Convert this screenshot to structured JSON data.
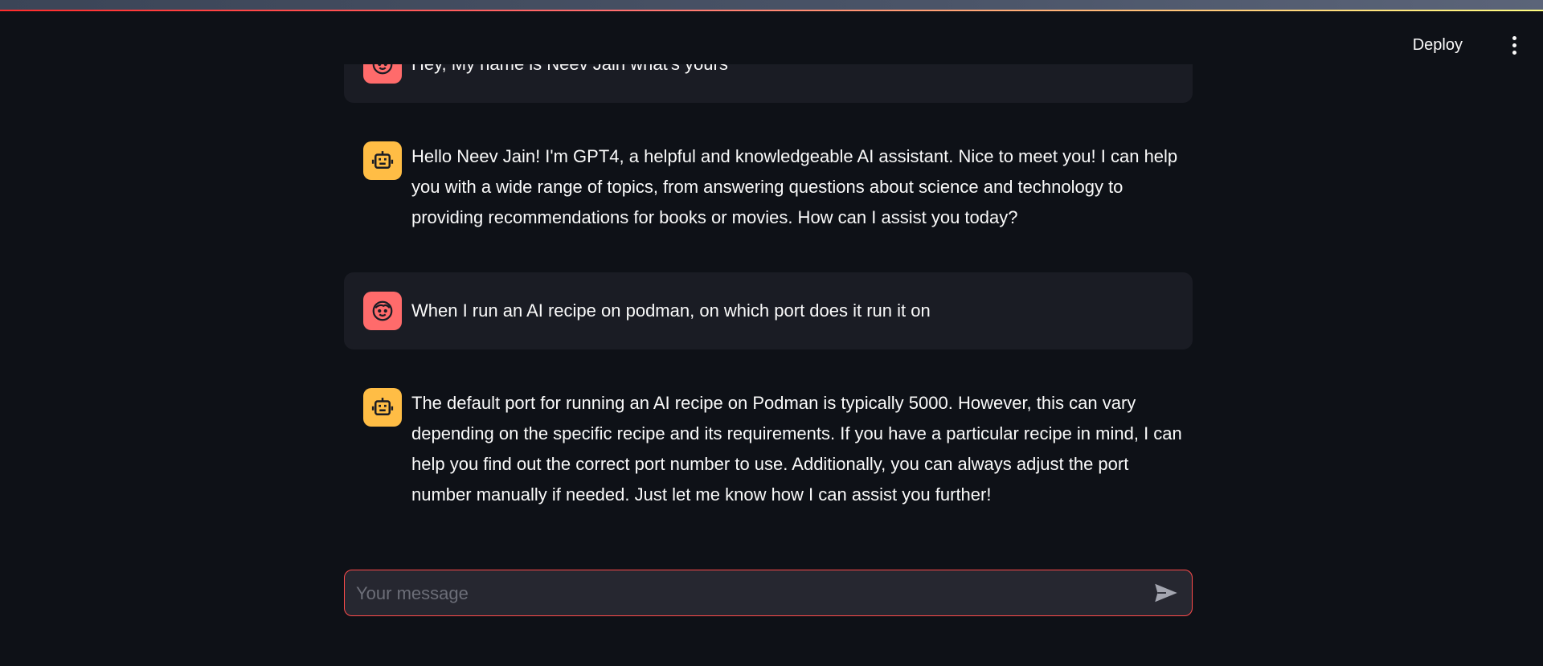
{
  "header": {
    "deploy_label": "Deploy",
    "menu_icon": "more-vertical-icon"
  },
  "messages": [
    {
      "role": "user",
      "icon": "user-face-icon",
      "text": "Hey, My name is Neev Jain what's yours"
    },
    {
      "role": "assistant",
      "icon": "robot-icon",
      "text": "Hello Neev Jain! I'm GPT4, a helpful and knowledgeable AI assistant. Nice to meet you! I can help you with a wide range of topics, from answering questions about science and technology to providing recommendations for books or movies. How can I assist you today?"
    },
    {
      "role": "user",
      "icon": "user-face-icon",
      "text": "When I run an AI recipe on podman, on which port does it run it on"
    },
    {
      "role": "assistant",
      "icon": "robot-icon",
      "text": "The default port for running an AI recipe on Podman is typically 5000. However, this can vary depending on the specific recipe and its requirements. If you have a particular recipe in mind, I can help you find out the correct port number to use. Additionally, you can always adjust the port number manually if needed. Just let me know how I can assist you further!"
    }
  ],
  "chat_input": {
    "placeholder": "Your message",
    "value": "",
    "send_icon": "send-icon"
  },
  "colors": {
    "background": "#0e1117",
    "user_bubble": "#1a1c24",
    "user_avatar": "#ff6b6b",
    "bot_avatar": "#ffbd45",
    "input_border": "#ff4b4b"
  }
}
